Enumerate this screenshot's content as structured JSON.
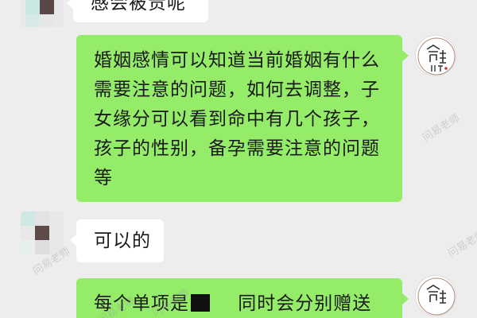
{
  "chat": {
    "messages": [
      {
        "side": "left",
        "text": "感会被贵呢"
      },
      {
        "side": "right",
        "lines": [
          "婚姻感情可以知道当前婚姻有什么",
          "需要注意的问题，如何去调整，子",
          "女缘分可以看到命中有几个孩子，",
          "孩子的性别，备孕需要注意的问题",
          "等"
        ]
      },
      {
        "side": "left",
        "text": "可以的"
      },
      {
        "side": "right",
        "prefix": "每个单项是",
        "suffix": "同时会分别赠送"
      }
    ],
    "avatar_logo_text": "命理师",
    "watermark": "问易老师"
  },
  "colors": {
    "background": "#ededed",
    "bubble_right": "#95ec69",
    "bubble_left": "#ffffff"
  }
}
